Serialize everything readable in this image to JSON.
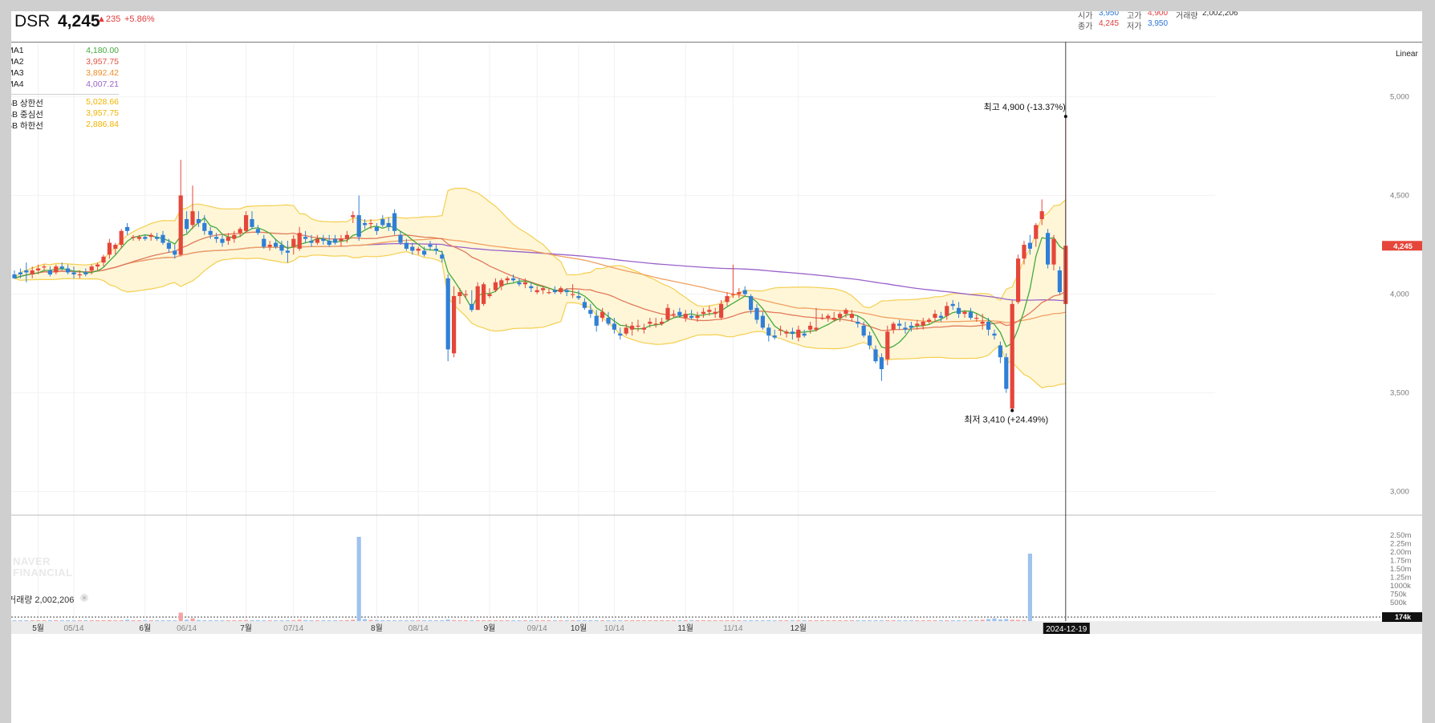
{
  "header": {
    "ticker": "DSR",
    "price": "4,245",
    "change": "▲235",
    "change_pct": "+5.86%",
    "quotes": [
      {
        "label": "시가",
        "value": "3,950",
        "color": "#2a74d6"
      },
      {
        "label": "고가",
        "value": "4,900",
        "color": "#e03c3c"
      },
      {
        "label": "거래량",
        "value": "2,002,206",
        "color": "#333333"
      },
      {
        "label": "종가",
        "value": "4,245",
        "color": "#e03c3c"
      },
      {
        "label": "저가",
        "value": "3,950",
        "color": "#2a74d6"
      }
    ]
  },
  "legend": {
    "ma": [
      {
        "name": "MA1",
        "value": "4,180.00",
        "color": "#44aa3c"
      },
      {
        "name": "MA2",
        "value": "3,957.75",
        "color": "#e05545"
      },
      {
        "name": "MA3",
        "value": "3,892.42",
        "color": "#f08c28"
      },
      {
        "name": "MA4",
        "value": "4,007.21",
        "color": "#9a62c9"
      }
    ],
    "bb": [
      {
        "name": "BB 상한선",
        "value": "5,028.66",
        "color": "#f0b400"
      },
      {
        "name": "BB 중심선",
        "value": "3,957.75",
        "color": "#f0b400"
      },
      {
        "name": "BB 하한선",
        "value": "2,886.84",
        "color": "#f0b400"
      }
    ]
  },
  "scale_mode": "Linear",
  "watermark": [
    "NAVER",
    "FINANCIAL"
  ],
  "volume": {
    "label": "거래량 2,002,206",
    "close": "×"
  },
  "current_price_tag": "4,245",
  "current_volume_tag": "174k",
  "current_date_tag": "2024-12-19",
  "annotations": {
    "high": "최고 4,900 (-13.37%)",
    "low": "최저 3,410 (+24.49%)"
  },
  "chart_data": {
    "type": "candlestick",
    "y_ticks": [
      3000,
      3500,
      4000,
      4500,
      5000
    ],
    "y_tick_labels": [
      "3,000",
      "3,500",
      "4,000",
      "4,500",
      "5,000"
    ],
    "ylim": [
      2880,
      5230
    ],
    "volume_ticks": [
      "2.50m",
      "2.25m",
      "2.00m",
      "1.75m",
      "1.50m",
      "1.25m",
      "1000k",
      "750k",
      "500k"
    ],
    "x_labels": [
      {
        "i": 4,
        "text": "5월",
        "sub": false
      },
      {
        "i": 10,
        "text": "05/14",
        "sub": true
      },
      {
        "i": 22,
        "text": "6월",
        "sub": false
      },
      {
        "i": 29,
        "text": "06/14",
        "sub": true
      },
      {
        "i": 39,
        "text": "7월",
        "sub": false
      },
      {
        "i": 47,
        "text": "07/14",
        "sub": true
      },
      {
        "i": 61,
        "text": "8월",
        "sub": false
      },
      {
        "i": 68,
        "text": "08/14",
        "sub": true
      },
      {
        "i": 80,
        "text": "9월",
        "sub": false
      },
      {
        "i": 88,
        "text": "09/14",
        "sub": true
      },
      {
        "i": 95,
        "text": "10월",
        "sub": false
      },
      {
        "i": 101,
        "text": "10/14",
        "sub": true
      },
      {
        "i": 113,
        "text": "11월",
        "sub": false
      },
      {
        "i": 121,
        "text": "11/14",
        "sub": true
      },
      {
        "i": 132,
        "text": "12월",
        "sub": false
      }
    ],
    "candles": [
      [
        4100,
        4120,
        4080,
        4080
      ],
      [
        4110,
        4130,
        4080,
        4100
      ],
      [
        4120,
        4160,
        4060,
        4110
      ],
      [
        4100,
        4140,
        4080,
        4120
      ],
      [
        4120,
        4150,
        4100,
        4130
      ],
      [
        4140,
        4150,
        4120,
        4140
      ],
      [
        4120,
        4140,
        4090,
        4100
      ],
      [
        4110,
        4150,
        4100,
        4140
      ],
      [
        4140,
        4160,
        4120,
        4130
      ],
      [
        4130,
        4150,
        4100,
        4110
      ],
      [
        4110,
        4140,
        4080,
        4100
      ],
      [
        4100,
        4120,
        4080,
        4100
      ],
      [
        4110,
        4130,
        4090,
        4100
      ],
      [
        4120,
        4150,
        4100,
        4140
      ],
      [
        4140,
        4160,
        4120,
        4150
      ],
      [
        4160,
        4200,
        4140,
        4190
      ],
      [
        4200,
        4280,
        4180,
        4260
      ],
      [
        4230,
        4260,
        4200,
        4250
      ],
      [
        4250,
        4330,
        4230,
        4320
      ],
      [
        4340,
        4360,
        4300,
        4320
      ],
      [
        4290,
        4300,
        4270,
        4290
      ],
      [
        4280,
        4300,
        4270,
        4290
      ],
      [
        4290,
        4300,
        4270,
        4280
      ],
      [
        4290,
        4310,
        4270,
        4300
      ],
      [
        4290,
        4310,
        4270,
        4280
      ],
      [
        4300,
        4320,
        4250,
        4260
      ],
      [
        4260,
        4280,
        4210,
        4230
      ],
      [
        4220,
        4250,
        4180,
        4200
      ],
      [
        4200,
        4680,
        4190,
        4500
      ],
      [
        4380,
        4420,
        4310,
        4330
      ],
      [
        4350,
        4550,
        4330,
        4420
      ],
      [
        4380,
        4420,
        4340,
        4360
      ],
      [
        4360,
        4400,
        4300,
        4320
      ],
      [
        4320,
        4340,
        4280,
        4300
      ],
      [
        4290,
        4310,
        4260,
        4280
      ],
      [
        4280,
        4300,
        4240,
        4260
      ],
      [
        4270,
        4310,
        4250,
        4290
      ],
      [
        4280,
        4320,
        4260,
        4300
      ],
      [
        4310,
        4340,
        4290,
        4330
      ],
      [
        4320,
        4420,
        4310,
        4400
      ],
      [
        4380,
        4420,
        4330,
        4340
      ],
      [
        4330,
        4350,
        4300,
        4310
      ],
      [
        4280,
        4300,
        4230,
        4240
      ],
      [
        4240,
        4270,
        4220,
        4250
      ],
      [
        4260,
        4280,
        4230,
        4240
      ],
      [
        4250,
        4270,
        4200,
        4220
      ],
      [
        4220,
        4270,
        4160,
        4210
      ],
      [
        4240,
        4300,
        4200,
        4280
      ],
      [
        4230,
        4340,
        4220,
        4310
      ],
      [
        4290,
        4320,
        4260,
        4280
      ],
      [
        4270,
        4300,
        4240,
        4260
      ],
      [
        4260,
        4300,
        4250,
        4280
      ],
      [
        4280,
        4300,
        4250,
        4270
      ],
      [
        4270,
        4300,
        4240,
        4250
      ],
      [
        4280,
        4300,
        4250,
        4260
      ],
      [
        4270,
        4300,
        4240,
        4280
      ],
      [
        4280,
        4320,
        4260,
        4300
      ],
      [
        4390,
        4420,
        4360,
        4400
      ],
      [
        4400,
        4500,
        4270,
        4290
      ],
      [
        4360,
        4380,
        4330,
        4350
      ],
      [
        4360,
        4380,
        4330,
        4360
      ],
      [
        4340,
        4360,
        4300,
        4320
      ],
      [
        4380,
        4400,
        4340,
        4350
      ],
      [
        4360,
        4390,
        4320,
        4340
      ],
      [
        4410,
        4430,
        4300,
        4320
      ],
      [
        4300,
        4320,
        4250,
        4260
      ],
      [
        4260,
        4280,
        4220,
        4230
      ],
      [
        4240,
        4260,
        4200,
        4220
      ],
      [
        4220,
        4240,
        4200,
        4230
      ],
      [
        4220,
        4240,
        4190,
        4200
      ],
      [
        4250,
        4270,
        4220,
        4240
      ],
      [
        4230,
        4250,
        4200,
        4220
      ],
      [
        4200,
        4220,
        4160,
        4180
      ],
      [
        4080,
        4100,
        3660,
        3720
      ],
      [
        3700,
        4040,
        3680,
        3990
      ],
      [
        3990,
        4030,
        3950,
        4010
      ],
      [
        4000,
        4020,
        3980,
        4000
      ],
      [
        3950,
        4020,
        3910,
        3920
      ],
      [
        3920,
        4060,
        3920,
        4040
      ],
      [
        3950,
        4060,
        3940,
        4050
      ],
      [
        3990,
        4030,
        3980,
        4000
      ],
      [
        4020,
        4080,
        4010,
        4060
      ],
      [
        4040,
        4080,
        4020,
        4070
      ],
      [
        4070,
        4090,
        4050,
        4080
      ],
      [
        4080,
        4100,
        4060,
        4070
      ],
      [
        4060,
        4080,
        4040,
        4050
      ],
      [
        4050,
        4080,
        4030,
        4060
      ],
      [
        4040,
        4060,
        4010,
        4030
      ],
      [
        4010,
        4040,
        4000,
        4020
      ],
      [
        4020,
        4040,
        4000,
        4030
      ],
      [
        4010,
        4030,
        4000,
        4010
      ],
      [
        4020,
        4040,
        4000,
        4010
      ],
      [
        4010,
        4040,
        4000,
        4030
      ],
      [
        4020,
        4030,
        3990,
        4010
      ],
      [
        4000,
        4050,
        3980,
        4000
      ],
      [
        3990,
        4020,
        3970,
        3980
      ],
      [
        3960,
        3980,
        3920,
        3930
      ],
      [
        3920,
        3950,
        3880,
        3900
      ],
      [
        3890,
        3920,
        3810,
        3840
      ],
      [
        3880,
        3930,
        3860,
        3910
      ],
      [
        3880,
        3910,
        3840,
        3850
      ],
      [
        3850,
        3880,
        3800,
        3820
      ],
      [
        3800,
        3830,
        3770,
        3790
      ],
      [
        3800,
        3850,
        3790,
        3830
      ],
      [
        3820,
        3860,
        3790,
        3840
      ],
      [
        3840,
        3870,
        3810,
        3840
      ],
      [
        3820,
        3850,
        3800,
        3830
      ],
      [
        3850,
        3880,
        3830,
        3860
      ],
      [
        3850,
        3880,
        3830,
        3850
      ],
      [
        3850,
        3880,
        3840,
        3860
      ],
      [
        3870,
        3950,
        3860,
        3930
      ],
      [
        3900,
        3920,
        3880,
        3900
      ],
      [
        3910,
        3930,
        3880,
        3890
      ],
      [
        3880,
        3920,
        3860,
        3900
      ],
      [
        3890,
        3920,
        3870,
        3880
      ],
      [
        3880,
        3910,
        3860,
        3890
      ],
      [
        3900,
        3930,
        3880,
        3910
      ],
      [
        3910,
        3940,
        3890,
        3920
      ],
      [
        3900,
        3930,
        3880,
        3910
      ],
      [
        3880,
        3970,
        3870,
        3950
      ],
      [
        3960,
        4010,
        3940,
        3990
      ],
      [
        4000,
        4150,
        3980,
        4000
      ],
      [
        4000,
        4030,
        3980,
        4010
      ],
      [
        4020,
        4040,
        3990,
        4000
      ],
      [
        3990,
        4000,
        3900,
        3920
      ],
      [
        3930,
        3950,
        3850,
        3870
      ],
      [
        3890,
        3910,
        3820,
        3830
      ],
      [
        3830,
        3850,
        3760,
        3790
      ],
      [
        3790,
        3820,
        3770,
        3780
      ],
      [
        3820,
        3840,
        3790,
        3820
      ],
      [
        3800,
        3820,
        3780,
        3810
      ],
      [
        3810,
        3830,
        3770,
        3800
      ],
      [
        3780,
        3840,
        3760,
        3820
      ],
      [
        3800,
        3820,
        3780,
        3790
      ],
      [
        3820,
        3860,
        3800,
        3840
      ],
      [
        3820,
        3930,
        3810,
        3830
      ],
      [
        3880,
        3900,
        3870,
        3880
      ],
      [
        3880,
        3900,
        3860,
        3890
      ],
      [
        3870,
        3910,
        3860,
        3880
      ],
      [
        3880,
        3910,
        3860,
        3900
      ],
      [
        3900,
        3930,
        3880,
        3920
      ],
      [
        3880,
        3920,
        3860,
        3900
      ],
      [
        3860,
        3890,
        3830,
        3850
      ],
      [
        3840,
        3860,
        3780,
        3790
      ],
      [
        3790,
        3810,
        3720,
        3740
      ],
      [
        3720,
        3740,
        3650,
        3660
      ],
      [
        3680,
        3700,
        3560,
        3620
      ],
      [
        3670,
        3840,
        3640,
        3810
      ],
      [
        3820,
        3860,
        3800,
        3850
      ],
      [
        3850,
        3870,
        3820,
        3840
      ],
      [
        3830,
        3860,
        3800,
        3820
      ],
      [
        3840,
        3860,
        3810,
        3830
      ],
      [
        3840,
        3870,
        3820,
        3850
      ],
      [
        3840,
        3880,
        3820,
        3860
      ],
      [
        3860,
        3880,
        3850,
        3870
      ],
      [
        3880,
        3920,
        3860,
        3900
      ],
      [
        3890,
        3910,
        3860,
        3880
      ],
      [
        3890,
        3960,
        3870,
        3940
      ],
      [
        3950,
        3970,
        3920,
        3940
      ],
      [
        3930,
        3960,
        3880,
        3900
      ],
      [
        3900,
        3920,
        3880,
        3910
      ],
      [
        3910,
        3930,
        3870,
        3880
      ],
      [
        3880,
        3900,
        3860,
        3880
      ],
      [
        3850,
        3900,
        3820,
        3860
      ],
      [
        3860,
        3880,
        3790,
        3820
      ],
      [
        3800,
        3820,
        3770,
        3790
      ],
      [
        3740,
        3760,
        3650,
        3680
      ],
      [
        3680,
        3700,
        3500,
        3520
      ],
      [
        3420,
        3970,
        3410,
        3950
      ],
      [
        3960,
        4200,
        3950,
        4180
      ],
      [
        4180,
        4270,
        4150,
        4250
      ],
      [
        4260,
        4300,
        4200,
        4230
      ],
      [
        4280,
        4360,
        4240,
        4350
      ],
      [
        4380,
        4480,
        4350,
        4420
      ],
      [
        4310,
        4330,
        4130,
        4150
      ],
      [
        4150,
        4300,
        4120,
        4280
      ],
      [
        4120,
        4140,
        4000,
        4010
      ],
      [
        3950,
        4900,
        3950,
        4245
      ]
    ],
    "volume_thousands": [
      20,
      18,
      15,
      16,
      14,
      12,
      15,
      14,
      13,
      12,
      12,
      11,
      12,
      13,
      14,
      16,
      30,
      20,
      25,
      40,
      18,
      15,
      14,
      16,
      15,
      14,
      12,
      10,
      250,
      40,
      80,
      30,
      25,
      20,
      18,
      16,
      15,
      14,
      20,
      30,
      22,
      18,
      16,
      15,
      14,
      18,
      20,
      25,
      40,
      30,
      25,
      20,
      18,
      16,
      15,
      14,
      30,
      40,
      2500,
      60,
      35,
      30,
      25,
      20,
      18,
      16,
      14,
      12,
      12,
      11,
      12,
      11,
      10,
      45,
      30,
      20,
      18,
      15,
      14,
      12,
      12,
      11,
      10,
      11,
      12,
      10,
      10,
      11,
      10,
      10,
      10,
      10,
      10,
      11,
      10,
      10,
      9,
      10,
      10,
      9,
      10,
      10,
      9,
      10,
      10,
      9,
      10,
      10,
      9,
      10,
      10,
      9,
      10,
      10,
      9,
      10,
      10,
      11,
      12,
      10,
      12,
      10,
      11,
      10,
      11,
      10,
      10,
      12,
      10,
      12,
      10,
      11,
      12,
      10,
      13,
      15,
      12,
      14,
      12,
      12,
      12,
      11,
      11,
      11,
      13,
      12,
      14,
      16,
      12,
      13,
      12,
      14,
      12,
      12,
      11,
      12,
      12,
      14,
      13,
      12,
      15,
      16,
      30,
      40,
      60,
      80,
      50,
      60,
      40,
      35,
      30,
      2002
    ]
  }
}
